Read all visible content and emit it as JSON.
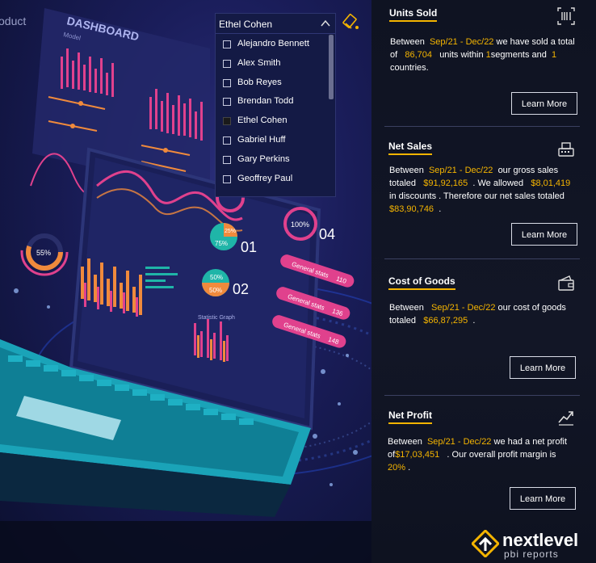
{
  "left": {
    "product_label": "oduct",
    "slicer": {
      "selected": "Ethel Cohen",
      "items": [
        {
          "label": "Alejandro Bennett",
          "checked": false
        },
        {
          "label": "Alex Smith",
          "checked": false
        },
        {
          "label": "Bob Reyes",
          "checked": false
        },
        {
          "label": "Brendan Todd",
          "checked": false
        },
        {
          "label": "Ethel Cohen",
          "checked": true
        },
        {
          "label": "Gabriel Huff",
          "checked": false
        },
        {
          "label": "Gary Perkins",
          "checked": false
        },
        {
          "label": "Geoffrey Paul",
          "checked": false
        }
      ]
    },
    "illustration": {
      "dashboard_title": "DASHBOARD",
      "model_label": "Model",
      "pct_55": "55%",
      "pct_25": "25%",
      "pct_75": "75%",
      "pct_50a": "50%",
      "pct_50b": "50%",
      "pct_100": "100%",
      "num_01": "01",
      "num_02": "02",
      "num_04": "04",
      "stats_label": "General stats",
      "stat_vals": [
        "110",
        "136",
        "148"
      ],
      "stat_graph": "Statistic Graph"
    }
  },
  "cards": {
    "units_sold": {
      "title": "Units Sold",
      "between": "Between",
      "period": "Sep/21 - Dec/22",
      "t1": "we have sold a total of",
      "units": "86,704",
      "t2": "units within",
      "segments": "1",
      "t3": "segments and",
      "countries": "1",
      "t4": "countries.",
      "button": "Learn More"
    },
    "net_sales": {
      "title": "Net Sales",
      "between": "Between",
      "period": "Sep/21 - Dec/22",
      "t1": "our gross sales totaled",
      "gross": "$91,92,165",
      "t2": ". We allowed",
      "discounts": "$8,01,419",
      "t3": "in discounts . Therefore our net sales totaled",
      "net": "$83,90,746",
      "t4": ".",
      "button": "Learn More"
    },
    "cost_of_goods": {
      "title": "Cost of Goods",
      "between": "Between",
      "period": "Sep/21 - Dec/22",
      "t1": "our cost of goods totaled",
      "cost": "$66,87,295",
      "t2": ".",
      "button": "Learn More"
    },
    "net_profit": {
      "title": "Net Profit",
      "between": "Between",
      "period": "Sep/21 - Dec/22",
      "t1": "we had a net profit of",
      "profit": "$17,03,451",
      "t2": ". Our overall profit margin is",
      "margin": "20%",
      "t3": ".",
      "button": "Learn More"
    }
  },
  "logo": {
    "main": "nextlevel",
    "sub": "pbi reports"
  },
  "colors": {
    "accent": "#f4b400",
    "panel": "#121626"
  }
}
